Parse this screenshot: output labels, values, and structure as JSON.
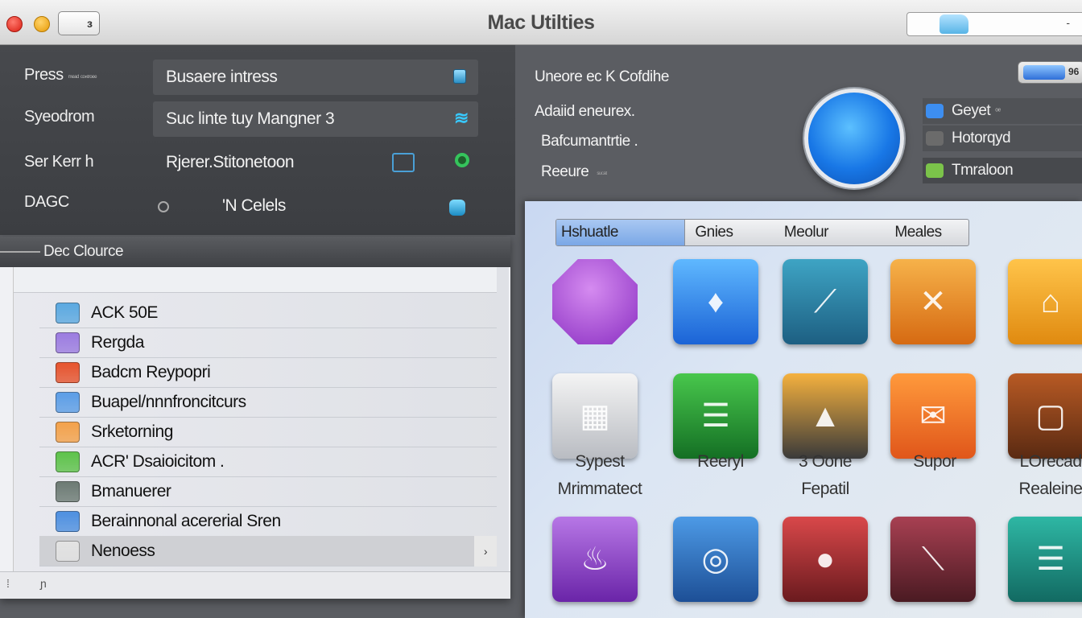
{
  "window": {
    "title": "Mac Utilties",
    "toolbar_button": "з",
    "search_mark": "-"
  },
  "left_panel": {
    "labels": [
      "Press",
      "Syeodrom",
      "Ser Kerr h",
      "DAGC"
    ],
    "label_small": [
      "ᵐᵉᵃᵈ ᶜᵒⁿᵗʳᵒᵉᵉ",
      "",
      "",
      ""
    ],
    "rows": [
      "Busaere intress",
      "Suc linte tuy Mangner 3",
      "Rjerer.Stitonetoon",
      "'N Celels"
    ]
  },
  "list_window": {
    "header": "Dec Clource",
    "items": [
      {
        "label": "ACK 50E",
        "color": "#5aa8e0"
      },
      {
        "label": "Rergda",
        "color": "#9b7be0"
      },
      {
        "label": "Badcm Reypopri",
        "color": "#e6532d"
      },
      {
        "label": "Buapel/nnnfroncitcurs",
        "color": "#5b9de6"
      },
      {
        "label": "Srketorning",
        "color": "#f3a14a"
      },
      {
        "label": "ACR' Dsaioicitom .",
        "color": "#5dc24a"
      },
      {
        "label": "Bmanuerer",
        "color": "#6c7a73"
      },
      {
        "label": "Berainnonal acererial Sren",
        "color": "#4d8fe0"
      },
      {
        "label": "Nenoess",
        "color": "#e2e2e2"
      }
    ],
    "selected_chevron": "›",
    "footer_marks": [
      "⁞",
      "ɲ"
    ]
  },
  "right_top": {
    "labels": [
      "Uneore ec K Cofdihe",
      "Adaiid eneurex.",
      "Bafcumantrtie .",
      "Reeure"
    ],
    "reeure_small": "ˢᵘᶜᵃᵗ",
    "toggle_label": "96",
    "side_items": [
      {
        "label": "Geyet",
        "small": "ᵒᵉ",
        "color": "#3d8ef0"
      },
      {
        "label": "Hotorqyd",
        "small": "",
        "color": "#6b6b6b"
      },
      {
        "label": "Tmraloon",
        "small": "",
        "color": "#7bc34a"
      }
    ]
  },
  "grid_panel": {
    "tabs": [
      "Hshuatle",
      "Gnies",
      "Meolur",
      "Meales"
    ],
    "active_tab": 0,
    "row1_icons": [
      "hexagon-icon",
      "water-drop-icon",
      "brush-icon",
      "tools-icon",
      "paintbrush-icon"
    ],
    "row2_icons": [
      "scanner-icon",
      "notes-icon",
      "printer-icon",
      "mail-icon",
      "frame-icon"
    ],
    "row2_labels": [
      [
        "Sypest",
        "Mrimmatect"
      ],
      [
        "Reeryl",
        ""
      ],
      [
        "3 Oone",
        "Fepatil"
      ],
      [
        "Supor",
        ""
      ],
      [
        "LOrecad",
        "Realeine"
      ]
    ],
    "row3_icons": [
      "lamp-icon",
      "dial-icon",
      "apple-icon",
      "pen-icon",
      "list-icon"
    ]
  }
}
